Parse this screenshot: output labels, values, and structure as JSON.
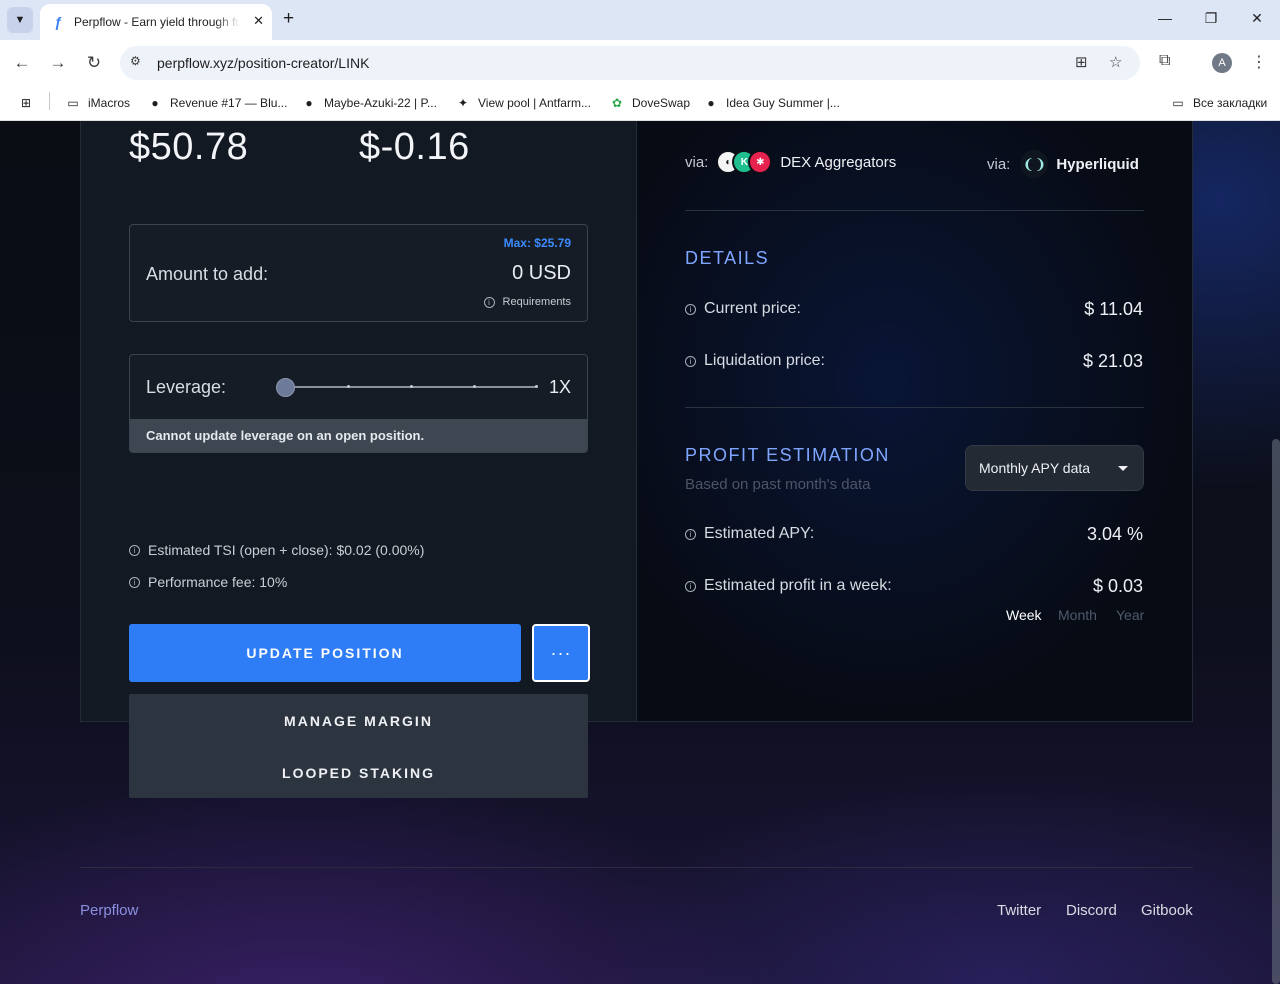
{
  "browser": {
    "tab_title": "Perpflow - Earn yield through funding",
    "url": "perpflow.xyz/position-creator/LINK",
    "bookmarks": [
      "iMacros",
      "Revenue #17 — Blu...",
      "Maybe-Azuki-22 | P...",
      "View pool | Antfarm...",
      "DoveSwap",
      "Idea Guy Summer |..."
    ],
    "all_bookmarks": "Все закладки",
    "avatar_letter": "A"
  },
  "position": {
    "value_left": "$50.78",
    "value_right": "$-0.16",
    "amount": {
      "label": "Amount to add:",
      "max": "Max: $25.79",
      "value": "0 USD",
      "requirements": "Requirements"
    },
    "leverage": {
      "label": "Leverage:",
      "value": "1X",
      "level": 0,
      "note": "Cannot update leverage on an open position."
    },
    "estimated_tsi": "Estimated TSI (open + close): $0.02 (0.00%)",
    "performance_fee": "Performance fee: 10%",
    "update_button": "UPDATE POSITION",
    "more_button": "···",
    "menu": [
      "MANAGE MARGIN",
      "LOOPED STAKING"
    ]
  },
  "venues": {
    "via_label": "via:",
    "left_name": "DEX Aggregators",
    "right_name": "Hyperliquid"
  },
  "details": {
    "title": "DETAILS",
    "current_price_label": "Current price:",
    "current_price": "$ 11.04",
    "liquidation_price_label": "Liquidation price:",
    "liquidation_price": "$ 21.03"
  },
  "profit": {
    "title": "PROFIT ESTIMATION",
    "subtitle": "Based on past month's data",
    "select": "Monthly APY data",
    "apy_label": "Estimated APY:",
    "apy_value": "3.04 %",
    "profit_label": "Estimated profit in a week:",
    "profit_value": "$ 0.03",
    "periods": [
      "Week",
      "Month",
      "Year"
    ],
    "active_period": "Week"
  },
  "footer": {
    "brand": "Perpflow",
    "links": [
      "Twitter",
      "Discord",
      "Gitbook"
    ]
  },
  "colors": {
    "accent": "#2f7df6",
    "section_title": "#7fa6ff"
  }
}
